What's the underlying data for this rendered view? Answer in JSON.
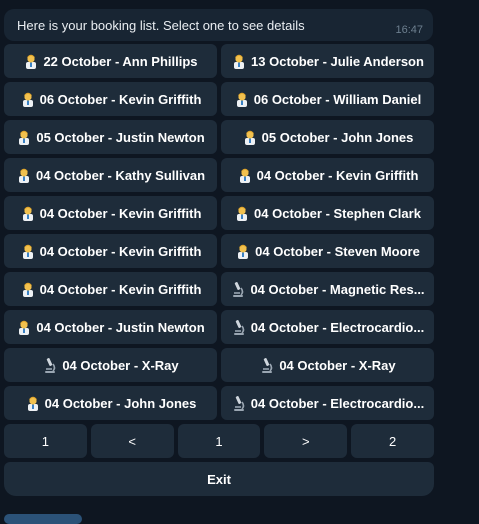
{
  "message": {
    "text": "Here is your booking list. Select one to see details",
    "time": "16:47"
  },
  "bookings": [
    [
      {
        "icon": "doctor-icon",
        "label": "22 October - Ann Phillips"
      },
      {
        "icon": "doctor-icon",
        "label": "13 October - Julie Anderson"
      }
    ],
    [
      {
        "icon": "doctor-icon",
        "label": "06 October - Kevin Griffith"
      },
      {
        "icon": "doctor-icon",
        "label": "06 October - William Daniel"
      }
    ],
    [
      {
        "icon": "doctor-icon",
        "label": "05 October - Justin Newton"
      },
      {
        "icon": "doctor-icon",
        "label": "05 October - John Jones"
      }
    ],
    [
      {
        "icon": "doctor-icon",
        "label": "04 October - Kathy Sullivan"
      },
      {
        "icon": "doctor-icon",
        "label": "04 October - Kevin Griffith"
      }
    ],
    [
      {
        "icon": "doctor-icon",
        "label": "04 October - Kevin Griffith"
      },
      {
        "icon": "doctor-icon",
        "label": "04 October - Stephen Clark"
      }
    ],
    [
      {
        "icon": "doctor-icon",
        "label": "04 October - Kevin Griffith"
      },
      {
        "icon": "doctor-icon",
        "label": "04 October - Steven Moore"
      }
    ],
    [
      {
        "icon": "doctor-icon",
        "label": "04 October - Kevin Griffith"
      },
      {
        "icon": "microscope-icon",
        "label": "04 October - Magnetic Res..."
      }
    ],
    [
      {
        "icon": "doctor-icon",
        "label": "04 October - Justin Newton"
      },
      {
        "icon": "microscope-icon",
        "label": "04 October - Electrocardio..."
      }
    ],
    [
      {
        "icon": "microscope-icon",
        "label": "04 October - X-Ray"
      },
      {
        "icon": "microscope-icon",
        "label": "04 October - X-Ray"
      }
    ],
    [
      {
        "icon": "doctor-icon",
        "label": "04 October - John Jones"
      },
      {
        "icon": "microscope-icon",
        "label": "04 October - Electrocardio..."
      }
    ]
  ],
  "pagination": [
    "1",
    "<",
    "1",
    ">",
    "2"
  ],
  "exit_label": "Exit",
  "colors": {
    "background": "#0e1621",
    "message_bubble": "#182533",
    "button": "#1e2c3a",
    "time_text": "#6d7f8f"
  }
}
